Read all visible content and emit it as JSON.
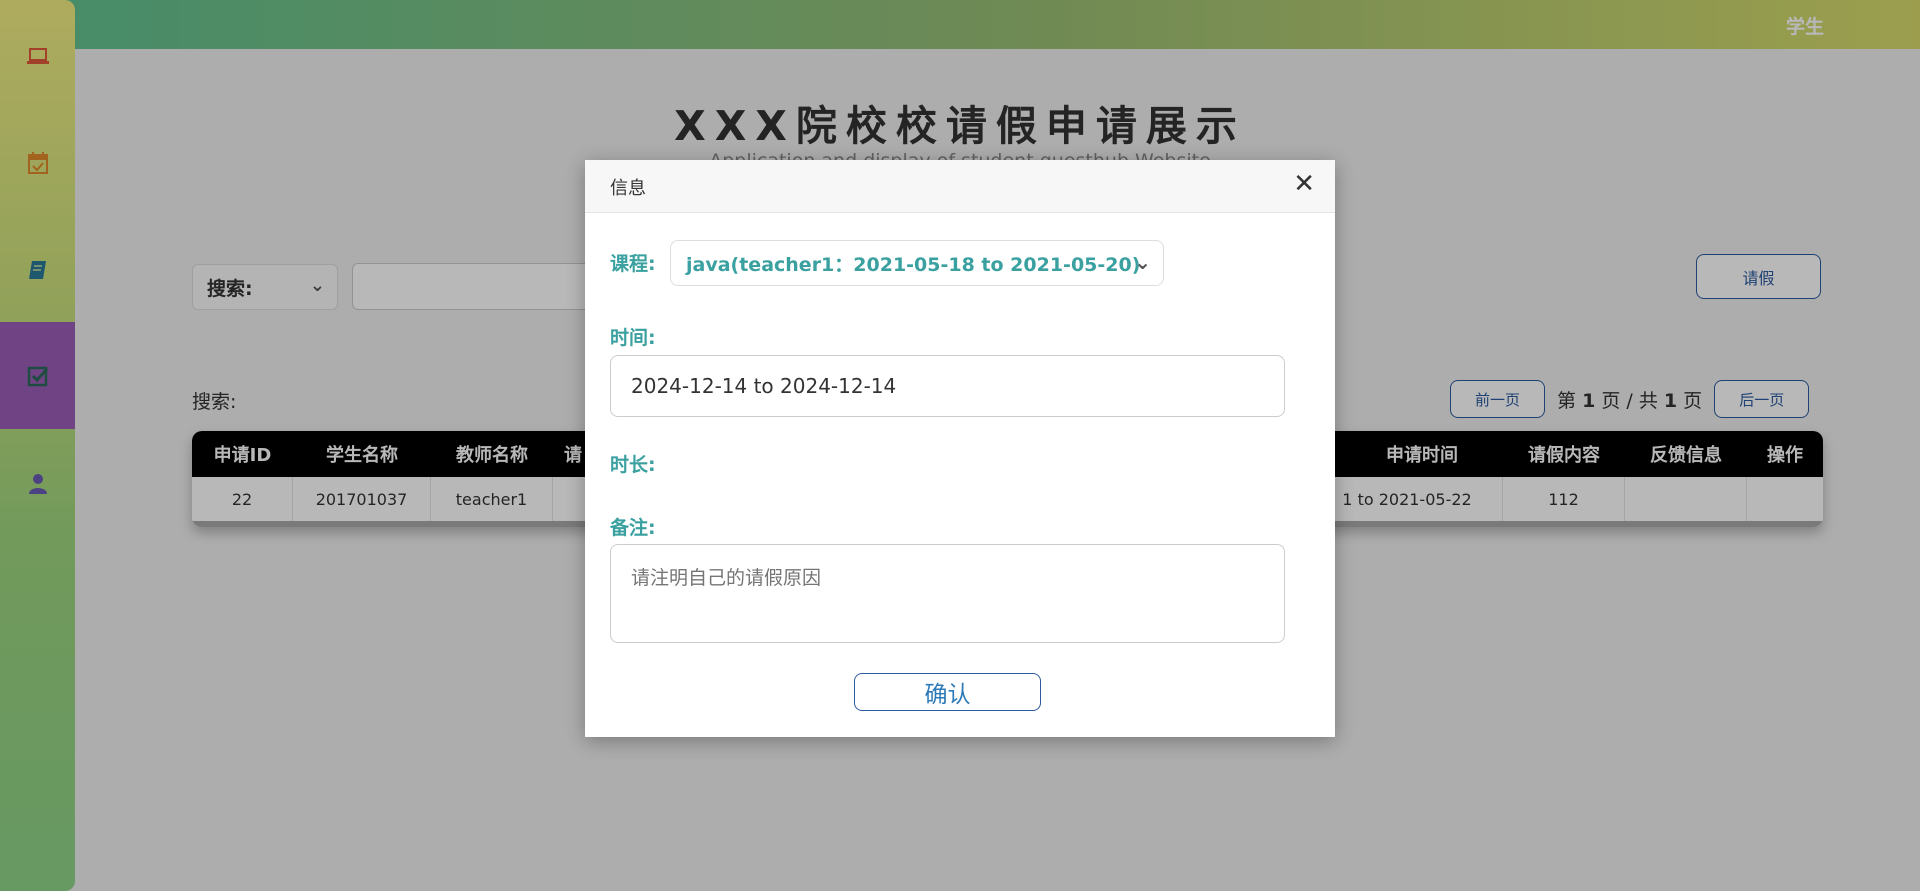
{
  "header": {
    "role": "学生"
  },
  "sidebar": {
    "items": [
      {
        "icon": "laptop-icon",
        "color": "#e05a3a"
      },
      {
        "icon": "calendar-check-icon",
        "color": "#e08a2a"
      },
      {
        "icon": "book-icon",
        "color": "#2a7a9a"
      },
      {
        "icon": "check-square-icon",
        "color": "#2a6a5a",
        "active": true
      },
      {
        "icon": "user-icon",
        "color": "#6a5ab5"
      }
    ],
    "active_color": "#9c5fb7"
  },
  "main": {
    "title": "XXX院校校请假申请展示",
    "subtitle": "Application and display of student questhub Website",
    "search_select": "搜索:",
    "search_label": "搜索:",
    "leave_button": "请假",
    "pager": {
      "prev": "前一页",
      "next": "后一页",
      "page_prefix": "第",
      "page": "1",
      "page_mid": "页 / 共",
      "total": "1",
      "page_suffix": "页"
    }
  },
  "table": {
    "headers": [
      "申请ID",
      "学生名称",
      "教师名称",
      "请",
      "申请时间",
      "请假内容",
      "反馈信息",
      "操作"
    ],
    "rows": [
      [
        "22",
        "201701037",
        "teacher1",
        "",
        "1 to 2021-05-22",
        "112",
        "",
        ""
      ]
    ]
  },
  "modal": {
    "title": "信息",
    "close": "✕",
    "course_label": "课程:",
    "course_value": "java(teacher1：2021-05-18 to 2021-05-20)",
    "time_label": "时间:",
    "time_value": "2024-12-14 to 2024-12-14",
    "duration_label": "时长:",
    "remark_label": "备注:",
    "remark_placeholder": "请注明自己的请假原因",
    "confirm": "确认"
  },
  "colors": {
    "accent": "#3aa0a0",
    "button_border": "#2c5aa0"
  }
}
